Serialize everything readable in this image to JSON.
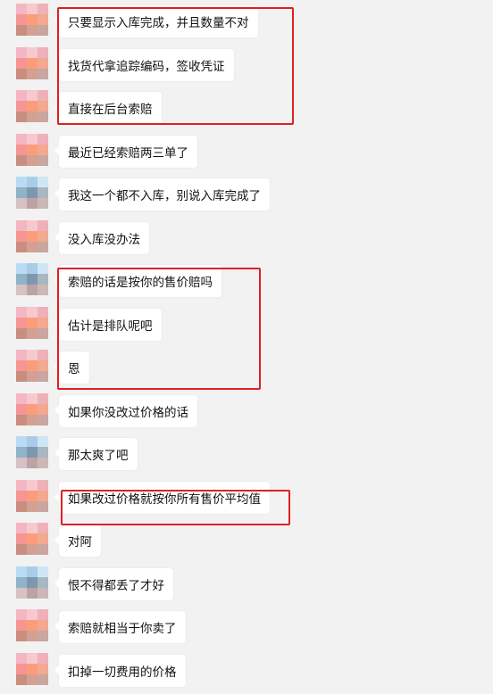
{
  "messages": [
    {
      "text": "只要显示入库完成，并且数量不对",
      "avatar": "pink"
    },
    {
      "text": "找货代拿追踪编码，签收凭证",
      "avatar": "pink"
    },
    {
      "text": "直接在后台索赔",
      "avatar": "pink"
    },
    {
      "text": "最近已经索赔两三单了",
      "avatar": "pink"
    },
    {
      "text": "我这一个都不入库，别说入库完成了",
      "avatar": "blue"
    },
    {
      "text": "没入库没办法",
      "avatar": "pink"
    },
    {
      "text": "索赔的话是按你的售价赔吗",
      "avatar": "blue"
    },
    {
      "text": "估计是排队呢吧",
      "avatar": "pink"
    },
    {
      "text": "恩",
      "avatar": "pink"
    },
    {
      "text": "如果你没改过价格的话",
      "avatar": "pink"
    },
    {
      "text": "那太爽了吧",
      "avatar": "blue"
    },
    {
      "text": "如果改过价格就按你所有售价平均值",
      "avatar": "pink"
    },
    {
      "text": "对阿",
      "avatar": "pink"
    },
    {
      "text": "恨不得都丢了才好",
      "avatar": "blue"
    },
    {
      "text": "索赔就相当于你卖了",
      "avatar": "pink"
    },
    {
      "text": "扣掉一切费用的价格",
      "avatar": "pink"
    }
  ],
  "highlight_color": "#e02020",
  "avatar_palettes": {
    "pink": [
      "#f4b6c2",
      "#f7c9cf",
      "#efb1b9",
      "#f79595",
      "#fb9d7a",
      "#f3a890",
      "#c98e80",
      "#d3a193",
      "#c9a6a0"
    ],
    "blue": [
      "#b9dcf3",
      "#a9cde8",
      "#cfe6f5",
      "#8fb3c9",
      "#7d98ae",
      "#a8b7c2",
      "#d8c1c5",
      "#bca3a6",
      "#cbb7b7"
    ]
  }
}
